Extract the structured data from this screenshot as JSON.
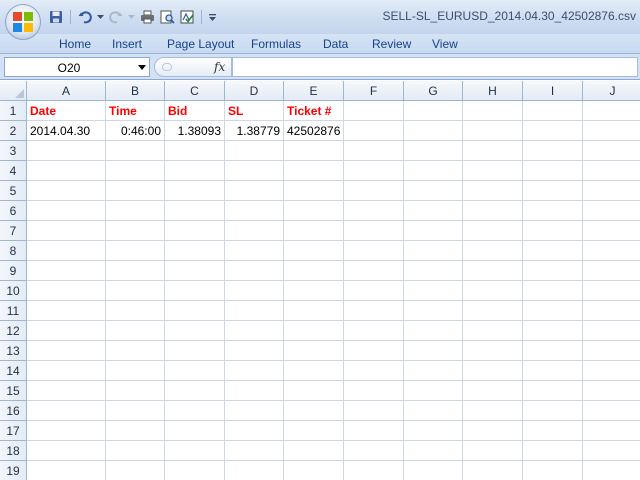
{
  "window": {
    "title": "SELL-SL_EURUSD_2014.04.30_42502876.csv"
  },
  "quick_access": [
    {
      "name": "save-icon"
    },
    {
      "name": "undo-icon"
    },
    {
      "name": "redo-icon"
    },
    {
      "name": "print-icon"
    },
    {
      "name": "print-preview-icon"
    },
    {
      "name": "spelling-icon"
    },
    {
      "name": "customize-qat-icon"
    }
  ],
  "ribbon": {
    "tabs": [
      "Home",
      "Insert",
      "Page Layout",
      "Formulas",
      "Data",
      "Review",
      "View"
    ]
  },
  "formula_bar": {
    "name_box": "O20",
    "fx_label": "fx",
    "value": ""
  },
  "sheet": {
    "columns": [
      "A",
      "B",
      "C",
      "D",
      "E",
      "F",
      "G",
      "H",
      "I",
      "J"
    ],
    "rows": [
      "1",
      "2",
      "3",
      "4",
      "5",
      "6",
      "7",
      "8",
      "9",
      "10",
      "11",
      "12",
      "13",
      "14",
      "15",
      "16",
      "17",
      "18",
      "19"
    ],
    "cells": {
      "A1": "Date",
      "B1": "Time",
      "C1": "Bid",
      "D1": "SL",
      "E1": "Ticket #",
      "A2": "2014.04.30",
      "B2": "0:46:00",
      "C2": "1.38093",
      "D2": "1.38779",
      "E2": "42502876"
    }
  },
  "colors": {
    "header_text": "#ff0000",
    "ribbon_text": "#15428b",
    "gridline": "#d0d7e5"
  }
}
